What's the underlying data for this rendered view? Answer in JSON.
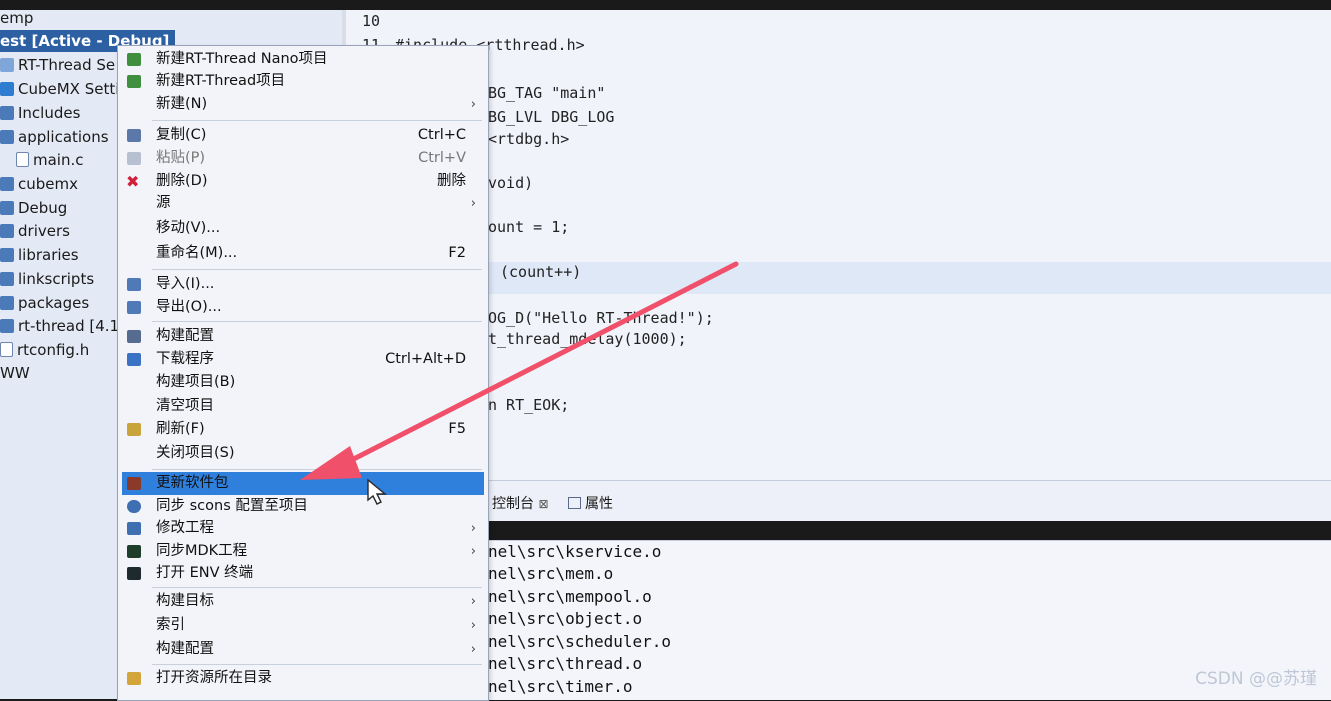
{
  "explorer": {
    "items": [
      {
        "label": "emp",
        "icon": "folder-icon"
      },
      {
        "label": "est   [Active - Debug]",
        "icon": ""
      },
      {
        "label": "RT-Thread Se",
        "icon": "rt-thread-icon"
      },
      {
        "label": "CubeMX Setti",
        "icon": "cubemx-icon"
      },
      {
        "label": "Includes",
        "icon": "folder-icon"
      },
      {
        "label": "applications",
        "icon": "folder-icon"
      },
      {
        "label": "main.c",
        "icon": "c-file-icon"
      },
      {
        "label": "cubemx",
        "icon": "folder-icon"
      },
      {
        "label": "Debug",
        "icon": "folder-icon"
      },
      {
        "label": "drivers",
        "icon": "folder-icon"
      },
      {
        "label": "libraries",
        "icon": "folder-icon"
      },
      {
        "label": "linkscripts",
        "icon": "folder-icon"
      },
      {
        "label": "packages",
        "icon": "folder-icon"
      },
      {
        "label": "rt-thread [4.1.",
        "icon": "folder-icon"
      },
      {
        "label": "rtconfig.h",
        "icon": "h-file-icon"
      },
      {
        "label": "WW",
        "icon": ""
      }
    ]
  },
  "editor": {
    "lines": [
      {
        "num": "10",
        "text": ""
      },
      {
        "num": "11",
        "text": "#include <rtthread.h>"
      },
      {
        "num": "",
        "text": "BG_TAG \"main\""
      },
      {
        "num": "",
        "text": "BG_LVL DBG_LOG"
      },
      {
        "num": "",
        "text": "<rtdbg.h>"
      },
      {
        "num": "",
        "text": "void)"
      },
      {
        "num": "",
        "text": "ount = 1;"
      },
      {
        "num": "",
        "text": "(count++)"
      },
      {
        "num": "",
        "text": "OG_D(\"Hello RT-Thread!\");"
      },
      {
        "num": "",
        "text": "t_thread_mdelay(1000);"
      },
      {
        "num": "",
        "text": "n RT_EOK;"
      }
    ]
  },
  "panel": {
    "tabs": [
      {
        "label": "控制台",
        "close": "⊠"
      },
      {
        "label": "属性"
      }
    ]
  },
  "console": {
    "lines": [
      "nel\\src\\kservice.o",
      "nel\\src\\mem.o",
      "nel\\src\\mempool.o",
      "nel\\src\\object.o",
      "nel\\src\\scheduler.o",
      "nel\\src\\thread.o",
      "nel\\src\\timer.o"
    ]
  },
  "menu": {
    "items": [
      {
        "label": "新建RT-Thread Nano项目",
        "accel": "",
        "submenu": false,
        "icon": "new-project-icon"
      },
      {
        "label": "新建RT-Thread项目",
        "accel": "",
        "submenu": false,
        "icon": "new-project-icon"
      },
      {
        "label": "新建(N)",
        "accel": "",
        "submenu": true,
        "icon": ""
      },
      {
        "label": "复制(C)",
        "accel": "Ctrl+C",
        "submenu": false,
        "icon": "copy-icon"
      },
      {
        "label": "粘贴(P)",
        "accel": "Ctrl+V",
        "submenu": false,
        "icon": "paste-icon"
      },
      {
        "label": "删除(D)",
        "accel": "删除",
        "submenu": false,
        "icon": "delete-icon"
      },
      {
        "label": "源",
        "accel": "",
        "submenu": true,
        "icon": ""
      },
      {
        "label": "移动(V)...",
        "accel": "",
        "submenu": false,
        "icon": ""
      },
      {
        "label": "重命名(M)...",
        "accel": "F2",
        "submenu": false,
        "icon": ""
      },
      {
        "label": "导入(I)...",
        "accel": "",
        "submenu": false,
        "icon": "import-icon"
      },
      {
        "label": "导出(O)...",
        "accel": "",
        "submenu": false,
        "icon": "export-icon"
      },
      {
        "label": "构建配置",
        "accel": "",
        "submenu": false,
        "icon": "build-config-icon"
      },
      {
        "label": "下载程序",
        "accel": "Ctrl+Alt+D",
        "submenu": false,
        "icon": "download-icon"
      },
      {
        "label": "构建项目(B)",
        "accel": "",
        "submenu": false,
        "icon": ""
      },
      {
        "label": "清空项目",
        "accel": "",
        "submenu": false,
        "icon": ""
      },
      {
        "label": "刷新(F)",
        "accel": "F5",
        "submenu": false,
        "icon": "refresh-icon"
      },
      {
        "label": "关闭项目(S)",
        "accel": "",
        "submenu": false,
        "icon": ""
      },
      {
        "label": "更新软件包",
        "accel": "",
        "submenu": false,
        "icon": "package-icon"
      },
      {
        "label": "同步 scons 配置至项目",
        "accel": "",
        "submenu": false,
        "icon": "sync-icon"
      },
      {
        "label": "修改工程",
        "accel": "",
        "submenu": true,
        "icon": "wrench-icon"
      },
      {
        "label": "同步MDK工程",
        "accel": "",
        "submenu": true,
        "icon": "mdk-icon"
      },
      {
        "label": "打开 ENV 终端",
        "accel": "",
        "submenu": false,
        "icon": "terminal-icon"
      },
      {
        "label": "构建目标",
        "accel": "",
        "submenu": true,
        "icon": ""
      },
      {
        "label": "索引",
        "accel": "",
        "submenu": true,
        "icon": ""
      },
      {
        "label": "构建配置",
        "accel": "",
        "submenu": true,
        "icon": ""
      },
      {
        "label": "打开资源所在目录",
        "accel": "",
        "submenu": false,
        "icon": "folder-open-icon"
      }
    ],
    "submenu_glyph": "›",
    "selected_color": "#2f7fdc"
  },
  "watermark": "CSDN @@苏瑾",
  "colors": {
    "arrow": "#f0506a",
    "selection": "#2f7fdc",
    "explorer_bg": "#e4eaf5"
  }
}
